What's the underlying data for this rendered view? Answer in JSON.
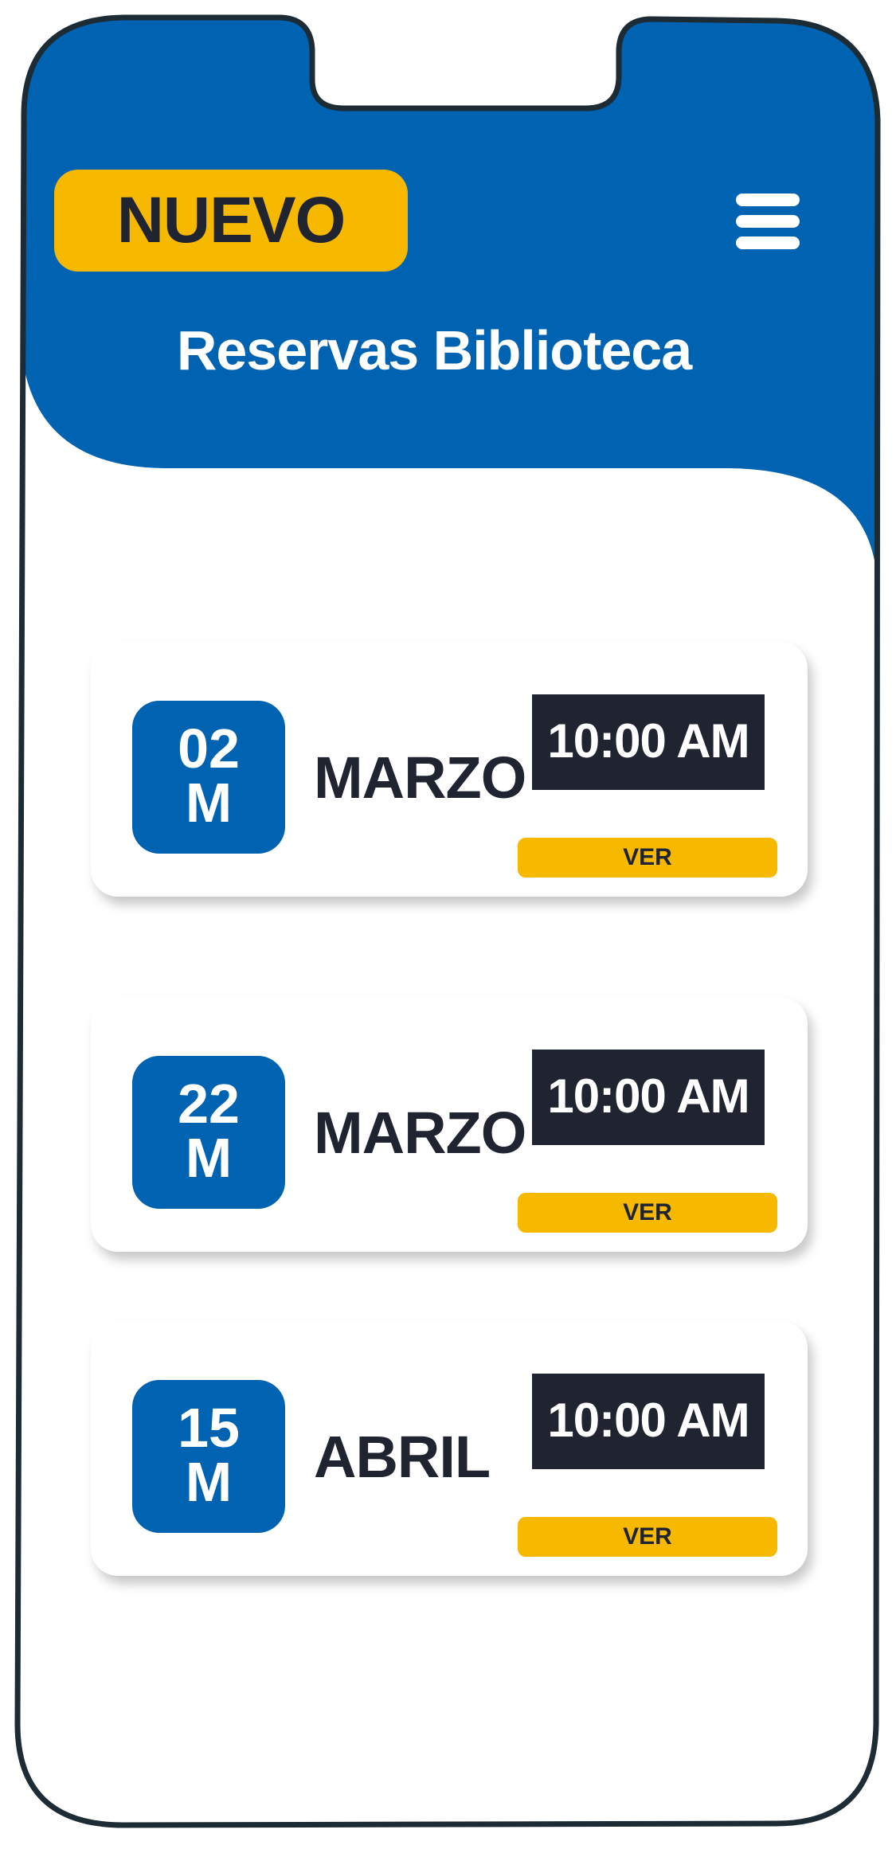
{
  "header": {
    "badge": "NUEVO",
    "title": "Reservas Biblioteca",
    "menu_icon": "hamburger-menu-icon"
  },
  "reservations": [
    {
      "day": "02",
      "day_suffix": "M",
      "month": "MARZO",
      "time": "10:00 AM",
      "action": "VER"
    },
    {
      "day": "22",
      "day_suffix": "M",
      "month": "MARZO",
      "time": "10:00 AM",
      "action": "VER"
    },
    {
      "day": "15",
      "day_suffix": "M",
      "month": "ABRIL",
      "time": "10:00 AM",
      "action": "VER"
    }
  ],
  "colors": {
    "primary_blue": "#0063b1",
    "accent_yellow": "#f7b900",
    "dark": "#202431",
    "frame": "#1d2b34"
  }
}
